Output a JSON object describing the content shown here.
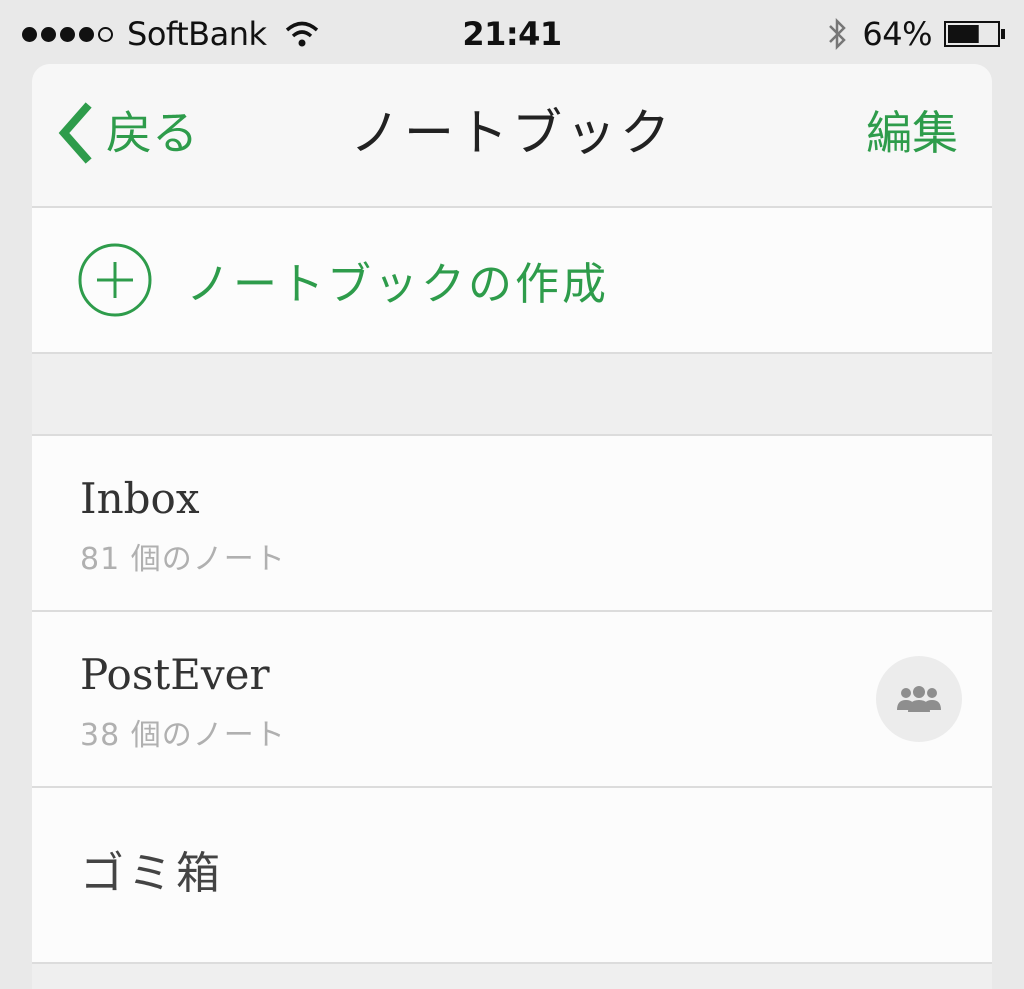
{
  "status_bar": {
    "carrier": "SoftBank",
    "time": "21:41",
    "battery_percent": "64%",
    "signal_bars_filled": 4,
    "signal_bars_total": 5,
    "battery_level": 0.64
  },
  "nav": {
    "back_label": "戻る",
    "title": "ノートブック",
    "edit_label": "編集"
  },
  "create": {
    "label": "ノートブックの作成"
  },
  "notebooks": [
    {
      "name": "Inbox",
      "count": "81 個のノート",
      "shared": false
    },
    {
      "name": "PostEver",
      "count": "38 個のノート",
      "shared": true
    }
  ],
  "trash": {
    "label": "ゴミ箱"
  },
  "colors": {
    "accent": "#2e9c4b",
    "subtext": "#b0b0b0",
    "background": "#f2f2f2"
  },
  "icons": [
    "chevron-left-icon",
    "plus-circle-icon",
    "shared-people-icon",
    "wifi-icon",
    "bluetooth-icon",
    "battery-icon"
  ]
}
